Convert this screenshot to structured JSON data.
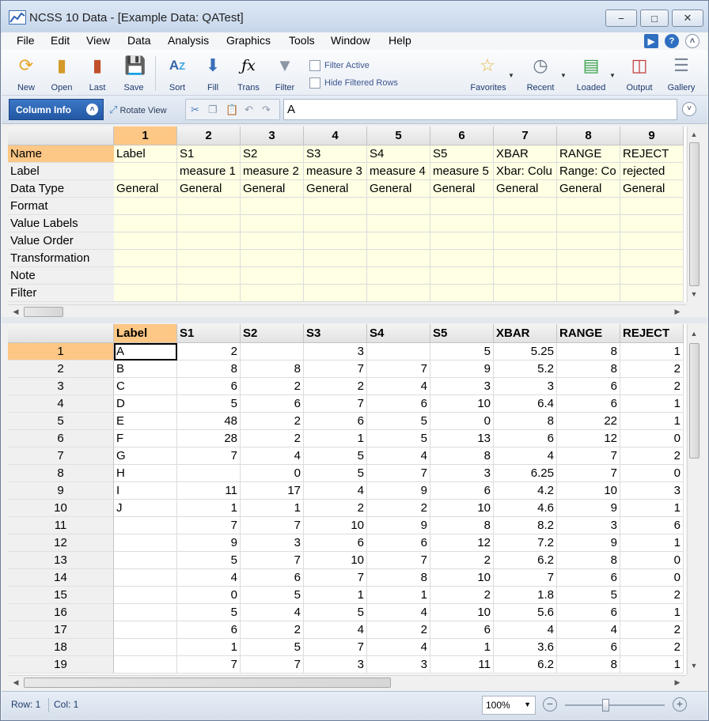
{
  "window": {
    "title": "NCSS 10 Data - [Example Data: QATest]"
  },
  "menu": [
    "File",
    "Edit",
    "View",
    "Data",
    "Analysis",
    "Graphics",
    "Tools",
    "Window",
    "Help"
  ],
  "toolbar": {
    "new": "New",
    "open": "Open",
    "last": "Last",
    "save": "Save",
    "sort": "Sort",
    "fill": "Fill",
    "trans": "Trans",
    "filter": "Filter",
    "filter_active": "Filter Active",
    "hide_filtered": "Hide Filtered Rows",
    "favorites": "Favorites",
    "recent": "Recent",
    "loaded": "Loaded",
    "output": "Output",
    "gallery": "Gallery"
  },
  "strip": {
    "column_info": "Column Info",
    "rotate_view": "Rotate View",
    "cell_value": "A"
  },
  "column_numbers": [
    "1",
    "2",
    "3",
    "4",
    "5",
    "6",
    "7",
    "8",
    "9"
  ],
  "column_info_rows": [
    {
      "name": "Name",
      "values": [
        "Label",
        "S1",
        "S2",
        "S3",
        "S4",
        "S5",
        "XBAR",
        "RANGE",
        "REJECT"
      ]
    },
    {
      "name": "Label",
      "values": [
        "",
        "measure 1",
        "measure 2",
        "measure 3",
        "measure 4",
        "measure 5",
        "Xbar: Colu",
        "Range: Co",
        "rejected"
      ]
    },
    {
      "name": "Data Type",
      "values": [
        "General",
        "General",
        "General",
        "General",
        "General",
        "General",
        "General",
        "General",
        "General"
      ]
    },
    {
      "name": "Format",
      "values": [
        "",
        "",
        "",
        "",
        "",
        "",
        "",
        "",
        ""
      ]
    },
    {
      "name": "Value Labels",
      "values": [
        "",
        "",
        "",
        "",
        "",
        "",
        "",
        "",
        ""
      ]
    },
    {
      "name": "Value Order",
      "values": [
        "",
        "",
        "",
        "",
        "",
        "",
        "",
        "",
        ""
      ]
    },
    {
      "name": "Transformation",
      "values": [
        "",
        "",
        "",
        "",
        "",
        "",
        "",
        "",
        ""
      ]
    },
    {
      "name": "Note",
      "values": [
        "",
        "",
        "",
        "",
        "",
        "",
        "",
        "",
        ""
      ]
    },
    {
      "name": "Filter",
      "values": [
        "",
        "",
        "",
        "",
        "",
        "",
        "",
        "",
        ""
      ]
    }
  ],
  "data_headers": [
    "Label",
    "S1",
    "S2",
    "S3",
    "S4",
    "S5",
    "XBAR",
    "RANGE",
    "REJECT"
  ],
  "data_rows": [
    [
      "1",
      "A",
      "2",
      "",
      "3",
      "",
      "5",
      "5.25",
      "8",
      "1"
    ],
    [
      "2",
      "B",
      "8",
      "8",
      "7",
      "7",
      "9",
      "5.2",
      "8",
      "2"
    ],
    [
      "3",
      "C",
      "6",
      "2",
      "2",
      "4",
      "3",
      "3",
      "6",
      "2"
    ],
    [
      "4",
      "D",
      "5",
      "6",
      "7",
      "6",
      "10",
      "6.4",
      "6",
      "1"
    ],
    [
      "5",
      "E",
      "48",
      "2",
      "6",
      "5",
      "0",
      "8",
      "22",
      "1"
    ],
    [
      "6",
      "F",
      "28",
      "2",
      "1",
      "5",
      "13",
      "6",
      "12",
      "0"
    ],
    [
      "7",
      "G",
      "7",
      "4",
      "5",
      "4",
      "8",
      "4",
      "7",
      "2"
    ],
    [
      "8",
      "H",
      "",
      "0",
      "5",
      "7",
      "3",
      "6.25",
      "7",
      "0"
    ],
    [
      "9",
      "I",
      "11",
      "17",
      "4",
      "9",
      "6",
      "4.2",
      "10",
      "3"
    ],
    [
      "10",
      "J",
      "1",
      "1",
      "2",
      "2",
      "10",
      "4.6",
      "9",
      "1"
    ],
    [
      "11",
      "",
      "7",
      "7",
      "10",
      "9",
      "8",
      "8.2",
      "3",
      "6"
    ],
    [
      "12",
      "",
      "9",
      "3",
      "6",
      "6",
      "12",
      "7.2",
      "9",
      "1"
    ],
    [
      "13",
      "",
      "5",
      "7",
      "10",
      "7",
      "2",
      "6.2",
      "8",
      "0"
    ],
    [
      "14",
      "",
      "4",
      "6",
      "7",
      "8",
      "10",
      "7",
      "6",
      "0"
    ],
    [
      "15",
      "",
      "0",
      "5",
      "1",
      "1",
      "2",
      "1.8",
      "5",
      "2"
    ],
    [
      "16",
      "",
      "5",
      "4",
      "5",
      "4",
      "10",
      "5.6",
      "6",
      "1"
    ],
    [
      "17",
      "",
      "6",
      "2",
      "4",
      "2",
      "6",
      "4",
      "4",
      "2"
    ],
    [
      "18",
      "",
      "1",
      "5",
      "7",
      "4",
      "1",
      "3.6",
      "6",
      "2"
    ],
    [
      "19",
      "",
      "7",
      "7",
      "3",
      "3",
      "11",
      "6.2",
      "8",
      "1"
    ]
  ],
  "status": {
    "row": "Row: 1",
    "col": "Col: 1",
    "zoom": "100%"
  }
}
